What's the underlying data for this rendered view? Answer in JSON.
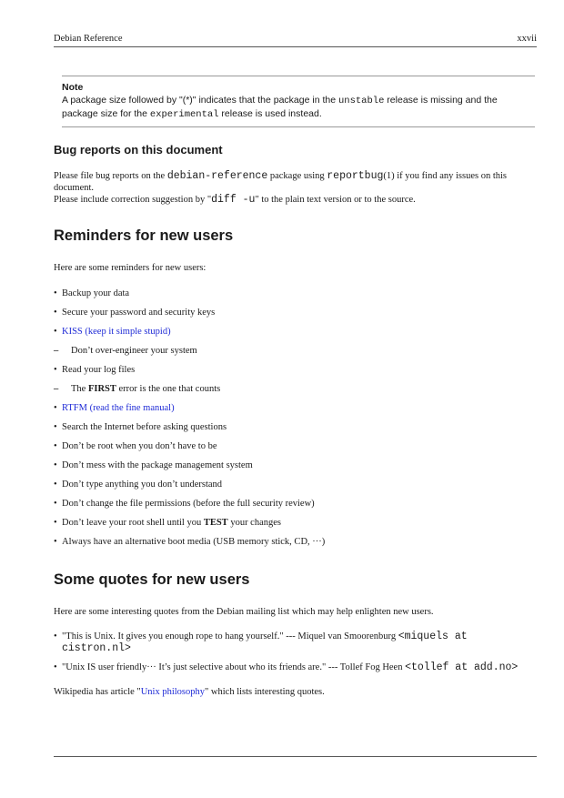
{
  "header": {
    "title": "Debian Reference",
    "page_number": "xxvii"
  },
  "note": {
    "title": "Note",
    "text_1": "A package size followed by \"(*)\" indicates that the package in the ",
    "code_1": "unstable",
    "text_2": " release is missing and the package size for the ",
    "code_2": "experimental",
    "text_3": " release is used instead."
  },
  "bug_reports": {
    "heading": "Bug reports on this document",
    "p1_a": "Please file bug reports on the ",
    "p1_code_pkg": "debian-reference",
    "p1_b": " package using ",
    "p1_code_cmd": "reportbug",
    "p1_c": "(1) if you find any issues on this document.",
    "p2_a": "Please include correction suggestion by \"",
    "p2_code": "diff -u",
    "p2_b": "\" to the plain text version or to the source."
  },
  "reminders": {
    "heading": "Reminders for new users",
    "intro": "Here are some reminders for new users:",
    "bullet": "•",
    "dash": "–",
    "items": [
      "Backup your data",
      "Secure your password and security keys",
      "KISS (keep it simple stupid)",
      "Don’t over-engineer your system",
      "Read your log files",
      "The ",
      "FIRST",
      " error is the one that counts",
      "RTFM (read the fine manual)",
      "Search the Internet before asking questions",
      "Don’t be root when you don’t have to be",
      "Don’t mess with the package management system",
      "Don’t type anything you don’t understand",
      "Don’t change the file permissions (before the full security review)",
      "Don’t leave your root shell until you ",
      "TEST",
      " your changes",
      "Always have an alternative boot media (USB memory stick, CD, ···)"
    ]
  },
  "quotes": {
    "heading": "Some quotes for new users",
    "intro": "Here are some interesting quotes from the Debian mailing list which may help enlighten new users.",
    "q1_text": "\"This is Unix. It gives you enough rope to hang yourself.\" --- Miquel van Smoorenburg ",
    "q1_email": "<miquels at cistron.nl>",
    "q2_text": "\"Unix IS user friendly··· It’s just selective about who its friends are.\" --- Tollef Fog Heen ",
    "q2_email": "<tollef at add.no>",
    "wiki_a": "Wikipedia has article \"",
    "wiki_link": "Unix philosophy",
    "wiki_b": "\" which lists interesting quotes."
  },
  "colors": {
    "link": "#1f2bd6",
    "rule": "#555555",
    "text": "#1a1a1a"
  }
}
